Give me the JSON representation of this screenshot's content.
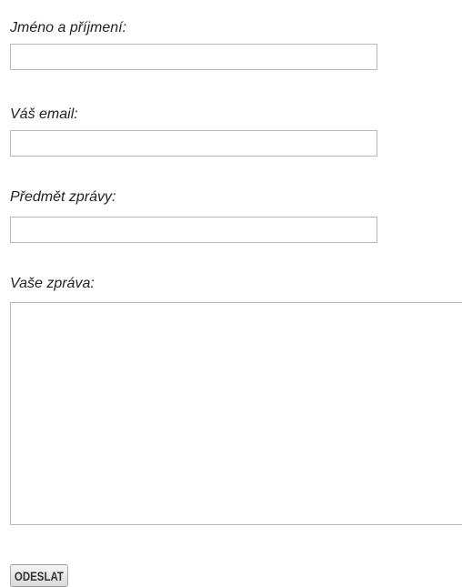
{
  "form": {
    "name_label": "Jméno a příjmení:",
    "name_value": "",
    "email_label": "Váš email:",
    "email_value": "",
    "subject_label": "Předmět zprávy:",
    "subject_value": "",
    "message_label": "Vaše zpráva:",
    "message_value": "",
    "submit_label": "ODESLAT"
  }
}
